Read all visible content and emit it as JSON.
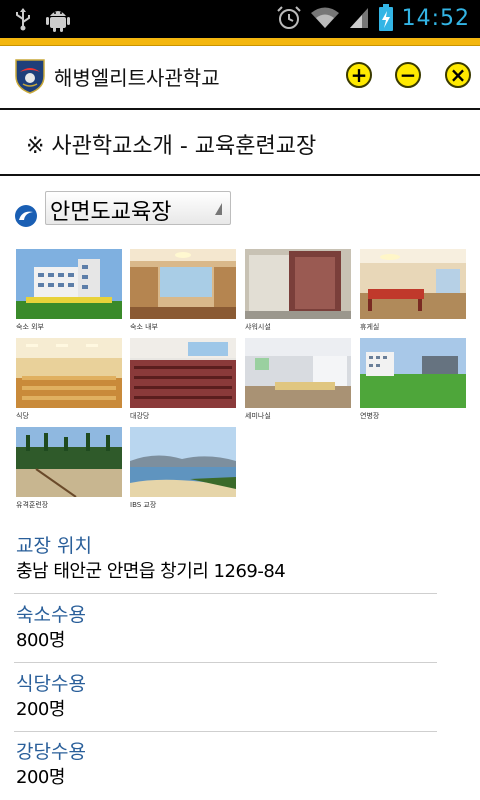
{
  "status_bar": {
    "time": "14:52",
    "icons": [
      "usb-icon",
      "android-debug-icon",
      "alarm-icon",
      "wifi-icon",
      "signal-icon",
      "battery-charging-icon"
    ]
  },
  "header": {
    "title": "해병엘리트사관학교",
    "buttons": {
      "add": "+",
      "remove": "−",
      "close": "×"
    },
    "accent_color": "#ffea00"
  },
  "section_title": "※ 사관학교소개 - 교육훈련교장",
  "location_select": {
    "selected": "안면도교육장"
  },
  "gallery": [
    {
      "caption": "숙소 외부"
    },
    {
      "caption": "숙소 내부"
    },
    {
      "caption": "샤워시설"
    },
    {
      "caption": "휴게실"
    },
    {
      "caption": "식당"
    },
    {
      "caption": "대강당"
    },
    {
      "caption": "세미나실"
    },
    {
      "caption": "연병장"
    },
    {
      "caption": "유격훈련장"
    },
    {
      "caption": "IBS 교장"
    }
  ],
  "info": [
    {
      "label": "교장 위치",
      "value": "충남 태안군 안면읍 창기리 1269-84"
    },
    {
      "label": "숙소수용",
      "value": "800명"
    },
    {
      "label": "식당수용",
      "value": "200명"
    },
    {
      "label": "강당수용",
      "value": "200명"
    }
  ],
  "colors": {
    "status_bar": "#000000",
    "strip": "#f4b70f",
    "label_blue": "#2a5f9a"
  }
}
